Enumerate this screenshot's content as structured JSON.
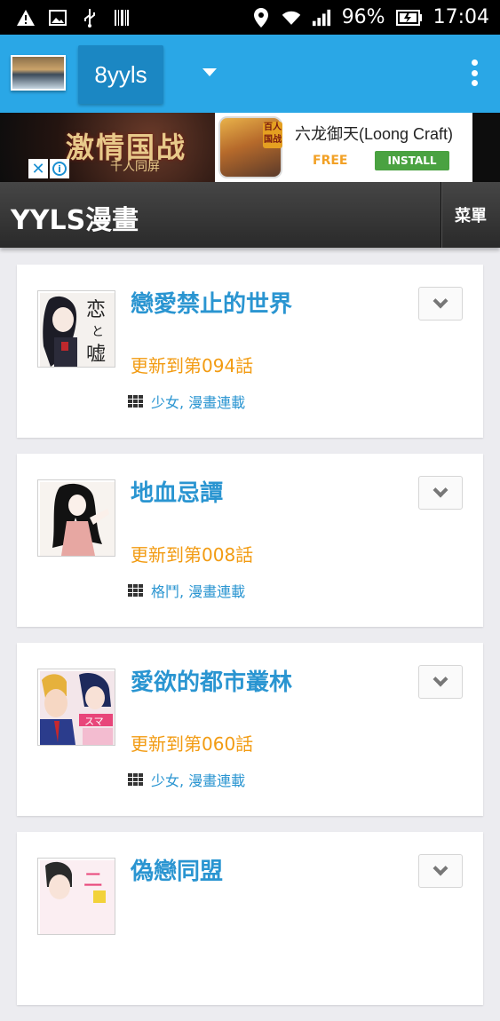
{
  "status_bar": {
    "battery": "96%",
    "time": "17:04",
    "icons": [
      "warning-icon",
      "image-icon",
      "usb-icon",
      "barcode-icon",
      "location-icon",
      "wifi-icon",
      "signal-icon",
      "battery-icon"
    ]
  },
  "app_bar": {
    "site_name": "8yyls",
    "icons": [
      "site-thumbnail",
      "dropdown-caret-icon",
      "overflow-menu-icon"
    ],
    "color": "#2aa7e6"
  },
  "ad": {
    "art_title": "激情国战",
    "art_subtitle": "千人同屏",
    "app_name": "六龙御天(Loong Craft)",
    "icon_badge": "百人 国战",
    "free_label": "FREE",
    "install_label": "INSTALL"
  },
  "page_header": {
    "title": "YYLS漫畫",
    "menu_label": "菜單"
  },
  "items": [
    {
      "title": "戀愛禁止的世界",
      "update": "更新到第094話",
      "tags": "少女, 漫畫連載"
    },
    {
      "title": "地血忌譚",
      "update": "更新到第008話",
      "tags": "格鬥, 漫畫連載"
    },
    {
      "title": "愛欲的都市叢林",
      "update": "更新到第060話",
      "tags": "少女, 漫畫連載"
    },
    {
      "title": "偽戀同盟",
      "update": "",
      "tags": ""
    }
  ],
  "colors": {
    "title_blue": "#2a95d1",
    "update_orange": "#f29b12",
    "header_dark": "#2a2a2a"
  }
}
